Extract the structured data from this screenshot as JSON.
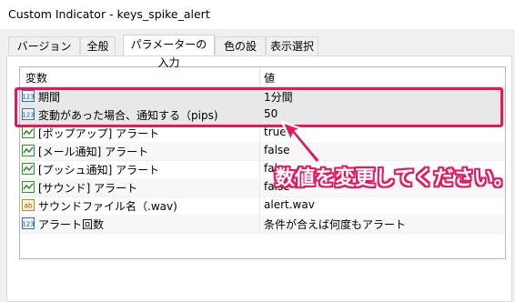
{
  "window": {
    "title": "Custom Indicator - keys_spike_alert"
  },
  "tabs": [
    {
      "label": "バージョン情報"
    },
    {
      "label": "全般"
    },
    {
      "label": "パラメーターの入力"
    },
    {
      "label": "色の設定"
    },
    {
      "label": "表示選択"
    }
  ],
  "grid": {
    "headers": {
      "variable": "変数",
      "value": "値"
    },
    "rows": [
      {
        "icon": "number-icon",
        "name": "期間",
        "value": "1分間"
      },
      {
        "icon": "number-icon",
        "name": "変動があった場合、通知する（pips)",
        "value": "50"
      },
      {
        "icon": "bool-icon",
        "name": "[ポップアップ] アラート",
        "value": "true"
      },
      {
        "icon": "bool-icon",
        "name": "[メール通知] アラート",
        "value": "false"
      },
      {
        "icon": "bool-icon",
        "name": "[プッシュ通知] アラート",
        "value": "false"
      },
      {
        "icon": "bool-icon",
        "name": "[サウンド] アラート",
        "value": "false"
      },
      {
        "icon": "string-icon",
        "name": "サウンドファイル名（.wav)",
        "value": "alert.wav"
      },
      {
        "icon": "number-icon",
        "name": "アラート回数",
        "value": "条件が合えば何度もアラート"
      }
    ]
  },
  "annotation": {
    "text": "数値を変更してください。",
    "color": "#e8175d"
  }
}
